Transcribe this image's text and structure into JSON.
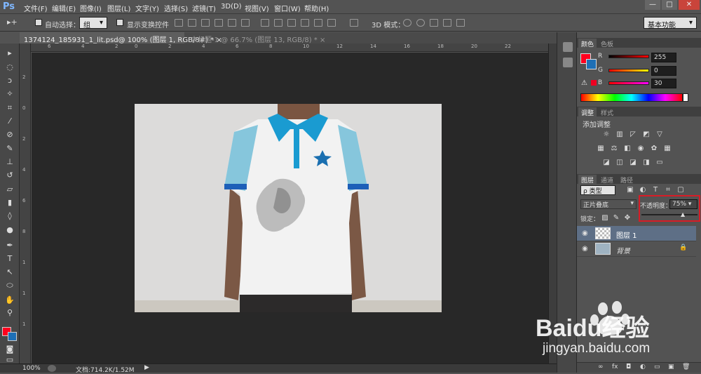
{
  "app": {
    "logo": "Ps",
    "window_controls": [
      "—",
      "□",
      "✕"
    ]
  },
  "menu": [
    "文件(F)",
    "编辑(E)",
    "图像(I)",
    "图层(L)",
    "文字(Y)",
    "选择(S)",
    "滤镜(T)",
    "3D(D)",
    "视图(V)",
    "窗口(W)",
    "帮助(H)"
  ],
  "options": {
    "auto_select_label": "自动选择：",
    "auto_select_value": "组",
    "show_transform_label": "显示变换控件",
    "mode3d_label": "3D 模式：",
    "workspace": "基本功能"
  },
  "tabs": [
    {
      "label": "1374124_185931_1_lit.psd@ 100% (图层 1, RGB/8#) *",
      "close": "×"
    },
    {
      "label": "未标题-1 @ 66.7% (图层 13, RGB/8) *",
      "close": "×"
    }
  ],
  "ruler_h": [
    "6",
    "4",
    "2",
    "0",
    "2",
    "4",
    "6",
    "8",
    "10",
    "12",
    "14",
    "16",
    "18",
    "20",
    "22"
  ],
  "ruler_v": [
    "2",
    "0",
    "2",
    "4",
    "6",
    "8",
    "1",
    "1",
    "1"
  ],
  "status": {
    "zoom": "100%",
    "doc": "文档:714.2K/1.52M"
  },
  "color_panel": {
    "tabs": [
      "颜色",
      "色板"
    ],
    "channels": [
      {
        "label": "R",
        "value": "255"
      },
      {
        "label": "G",
        "value": "0"
      },
      {
        "label": "B",
        "value": "30"
      }
    ],
    "fg": "#ff001e",
    "bg": "#1e6fb5"
  },
  "adjust_panel": {
    "tabs": [
      "调整",
      "样式"
    ],
    "title": "添加调整"
  },
  "layers_panel": {
    "tabs": [
      "图层",
      "通道",
      "路径"
    ],
    "filter": "ρ 类型",
    "blend": "正片叠底",
    "opacity_label": "不透明度：",
    "opacity": "75%",
    "opacity_level": 0.75,
    "lock_label": "锁定：",
    "layers": [
      {
        "name": "图层 1",
        "selected": true
      },
      {
        "name": "背景",
        "selected": false
      }
    ],
    "bottom_icons": [
      "∞",
      "fx",
      "◘",
      "◐",
      "▭",
      "▣",
      "🗑"
    ]
  },
  "watermark": {
    "brand": "Baidu经验",
    "url": "jingyan.baidu.com"
  }
}
